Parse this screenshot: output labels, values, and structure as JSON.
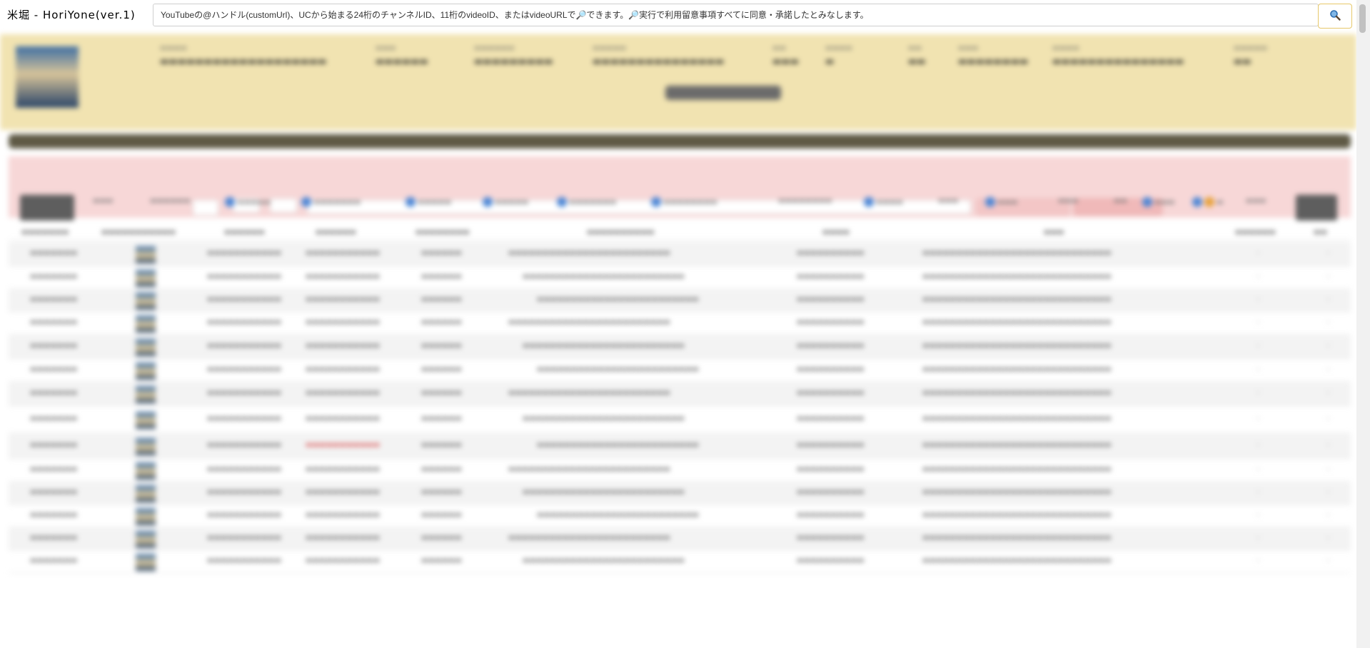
{
  "app": {
    "title": "米堀 - HoriYone(ver.1)"
  },
  "search": {
    "placeholder": "YouTubeの@ハンドル(customUrl)、UCから始まる24桁のチャンネルID、11桁のvideoID、またはvideoURLで🔎できます。🔎実行で利用留意事項すべてに同意・承諾したとみなします。",
    "button_icon": "magnifier-icon"
  },
  "colors": {
    "header_bg": "#f1e3b1",
    "filter_bg": "#f7d7d7",
    "section_bar": "#5f5a45",
    "accent_border": "#e7c86a"
  }
}
